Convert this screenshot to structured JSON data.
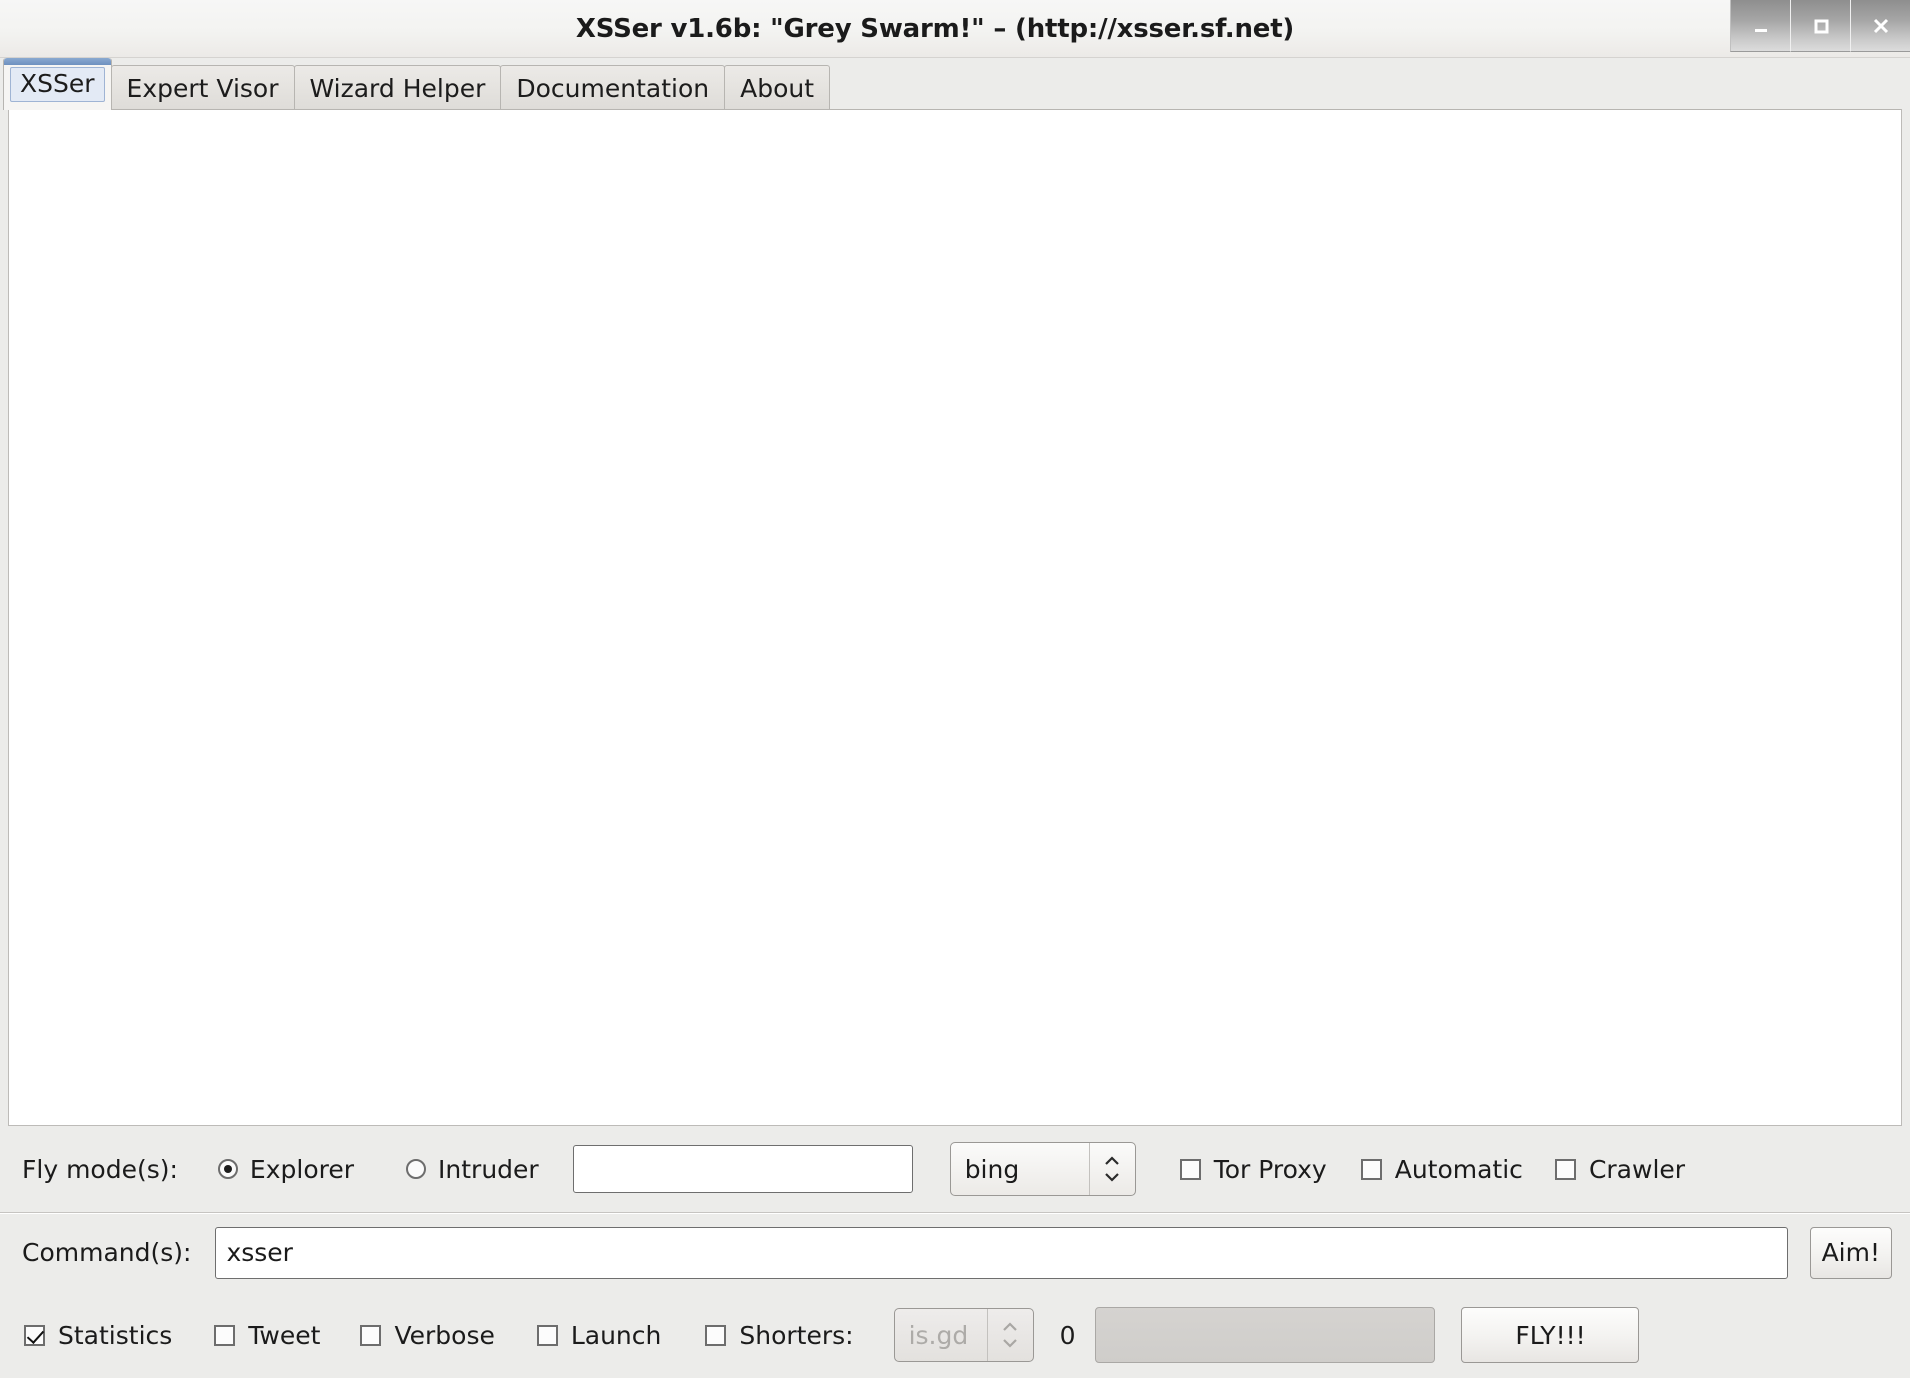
{
  "window": {
    "title": "XSSer v1.6b: \"Grey Swarm!\" – (http://xsser.sf.net)",
    "controls": {
      "minimize": "minimize-icon",
      "maximize": "maximize-icon",
      "close": "close-icon"
    }
  },
  "tabs": [
    {
      "label": "XSSer",
      "active": true
    },
    {
      "label": "Expert Visor",
      "active": false
    },
    {
      "label": "Wizard Helper",
      "active": false
    },
    {
      "label": "Documentation",
      "active": false
    },
    {
      "label": "About",
      "active": false
    }
  ],
  "fly_modes": {
    "label": "Fly mode(s):",
    "options": [
      {
        "label": "Explorer",
        "selected": true
      },
      {
        "label": "Intruder",
        "selected": false
      }
    ],
    "target_input": {
      "value": "",
      "placeholder": ""
    },
    "search_engine": {
      "value": "bing"
    },
    "checkboxes": [
      {
        "label": "Tor Proxy",
        "checked": false
      },
      {
        "label": "Automatic",
        "checked": false
      },
      {
        "label": "Crawler",
        "checked": false
      }
    ]
  },
  "command": {
    "label": "Command(s):",
    "value": "xsser",
    "placeholder": "",
    "aim_button": "Aim!"
  },
  "flags": {
    "checkboxes": [
      {
        "label": "Statistics",
        "checked": true
      },
      {
        "label": "Tweet",
        "checked": false
      },
      {
        "label": "Verbose",
        "checked": false
      },
      {
        "label": "Launch",
        "checked": false
      },
      {
        "label": "Shorters:",
        "checked": false
      }
    ],
    "shorter_service": {
      "value": "is.gd",
      "disabled": true
    },
    "progress_value": "0",
    "fly_button": "FLY!!!"
  },
  "colors": {
    "window_bg": "#ececea",
    "tab_accent": "#6e90bf",
    "content_bg": "#ffffff",
    "text": "#1b1b1b"
  }
}
